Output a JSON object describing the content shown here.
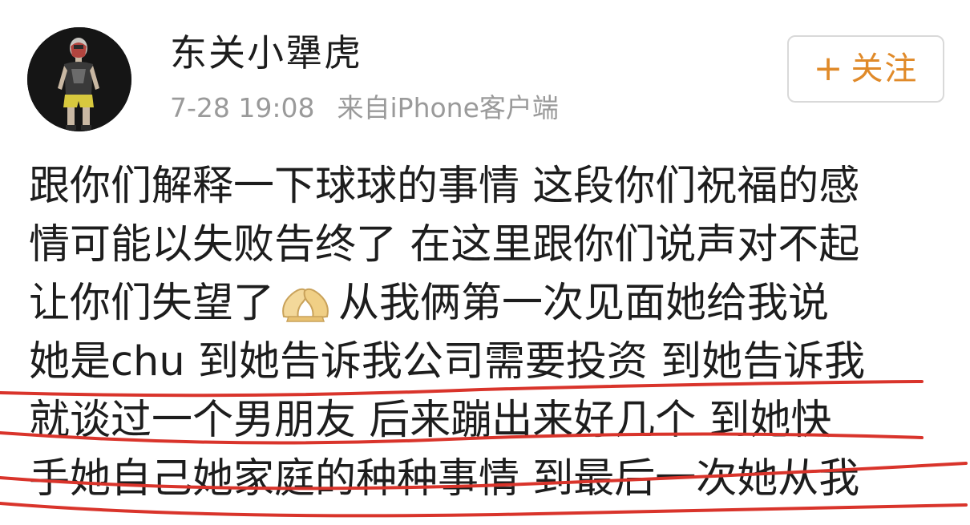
{
  "post": {
    "username": "东关小犟虎",
    "time": "7-28 19:08",
    "source": "来自iPhone客户端",
    "follow_plus": "+",
    "follow_label": "关注",
    "body_lines": [
      "跟你们解释一下球球的事情 这段你们祝福的感",
      "情可能以失败告终了 在这里跟你们说声对不起",
      "让你们失望了",
      "从我俩第一次见面她给我说",
      "她是chu 到她告诉我公司需要投资 到她告诉我",
      "就谈过一个男朋友 后来蹦出来好几个 到她快",
      "手她自己她家庭的种种事情 到最后一次她从我"
    ],
    "emoji": "praying-hands-icon"
  },
  "colors": {
    "text": "#1d1d1d",
    "meta": "#9a9a9a",
    "follow": "#e08a29",
    "annotation": "#d9342b"
  }
}
